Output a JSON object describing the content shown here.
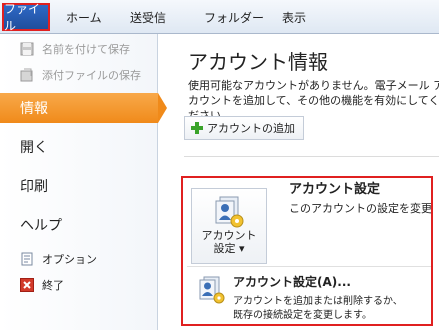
{
  "ribbon": {
    "file_tab": "ファイル",
    "tabs": [
      "ホーム",
      "送受信",
      "フォルダー",
      "表示"
    ]
  },
  "nav": {
    "commands": [
      {
        "label": "名前を付けて保存",
        "icon": "save-as-icon"
      },
      {
        "label": "添付ファイルの保存",
        "icon": "save-attachments-icon"
      }
    ],
    "items": [
      {
        "label": "情報",
        "active": true
      },
      {
        "label": "開く",
        "active": false
      },
      {
        "label": "印刷",
        "active": false
      },
      {
        "label": "ヘルプ",
        "active": false
      }
    ],
    "options_label": "オプション",
    "exit_label": "終了"
  },
  "main": {
    "title": "アカウント情報",
    "description": "使用可能なアカウントがありません。電子メール アカウントを追加して、その他の機能を有効にしてください。",
    "add_account_label": "アカウントの追加",
    "account_settings": {
      "button_line1": "アカウント",
      "button_line2": "設定 ▾",
      "heading": "アカウント設定",
      "description": "このアカウントの設定を変更します",
      "menu_item": {
        "title": "アカウント設定(A)...",
        "desc_line1": "アカウントを追加または削除するか、",
        "desc_line2": "既存の接続設定を変更します。"
      }
    }
  },
  "colors": {
    "file_tab": "#1f4e9c",
    "active_nav": "#f08a1a",
    "highlight_border": "#e02020",
    "plus_green": "#3aa32a"
  }
}
